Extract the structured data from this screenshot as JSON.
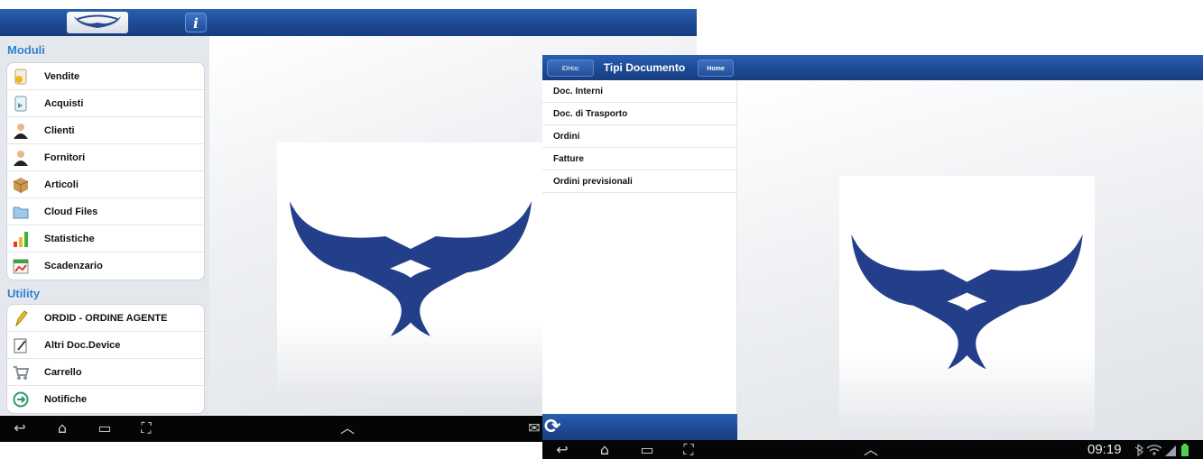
{
  "screen1": {
    "info_label": "i",
    "sections": [
      {
        "title": "Moduli",
        "items": [
          {
            "label": "Vendite",
            "icon": "sales-doc-icon"
          },
          {
            "label": "Acquisti",
            "icon": "purchase-doc-icon"
          },
          {
            "label": "Clienti",
            "icon": "customer-person-icon"
          },
          {
            "label": "Fornitori",
            "icon": "supplier-person-icon"
          },
          {
            "label": "Articoli",
            "icon": "box-icon"
          },
          {
            "label": "Cloud Files",
            "icon": "folder-icon"
          },
          {
            "label": "Statistiche",
            "icon": "bar-chart-icon"
          },
          {
            "label": "Scadenzario",
            "icon": "calendar-chart-icon"
          }
        ]
      },
      {
        "title": "Utility",
        "items": [
          {
            "label": "ORDID - ORDINE AGENTE",
            "icon": "pen-icon"
          },
          {
            "label": "Altri Doc.Device",
            "icon": "edit-doc-icon"
          },
          {
            "label": "Carrello",
            "icon": "cart-icon"
          },
          {
            "label": "Notifiche",
            "icon": "notification-icon"
          }
        ]
      }
    ]
  },
  "screen2": {
    "back_label": "iDHoc",
    "title": "Tipi Documento",
    "home_label": "Home",
    "items": [
      "Doc. Interni",
      "Doc. di Trasporto",
      "Ordini",
      "Fatture",
      "Ordini previsionali"
    ],
    "clock": "09:19"
  },
  "colors": {
    "topbar": "#1d4a94",
    "section_header": "#2f7fd0",
    "logo_blue": "#233f8a",
    "navbar": "#050505"
  }
}
